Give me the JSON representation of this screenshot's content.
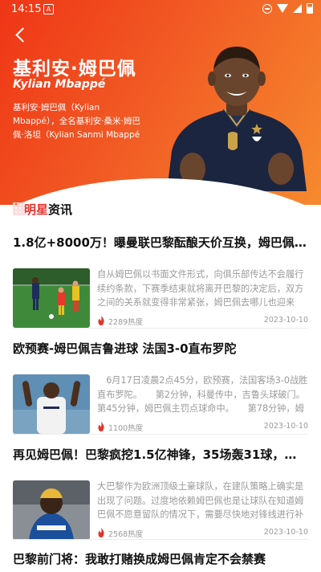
{
  "status": {
    "time": "14:15",
    "app_badge": "A"
  },
  "header": {
    "cn_name": "基利安·姆巴佩",
    "en_name": "Kylian Mbappé",
    "bio": "基利安·姆巴佩（Kylian Mbappé），全名基利安·桑米·姆巴佩·洛坦（Kylian Sanmi Mbappé"
  },
  "section": {
    "title_red": "明星",
    "title_black": "资讯"
  },
  "news": [
    {
      "title": "1.8亿+8000万！曝曼联巴黎酝酿天价互换，姆巴佩去英超...",
      "summary": "自从姆巴佩以书面文件形式，向俱乐部传达不会履行续约条款，下赛季结束就将离开巴黎的决定后，双方之间的关系就变得非常紧张，姆巴佩去哪儿也迎来了“第二季”。...",
      "heat": "2289热度",
      "date": "2023-10-10",
      "thumb": "match-photo"
    },
    {
      "title": "欧预赛-姆巴佩吉鲁进球 法国3-0直布罗陀",
      "summary": "　6月17日凌晨2点45分，欧预赛，法国客场3-0战胜直布罗陀。　　第2分钟，科曼传中，吉鲁头球破门。第45分钟，姆巴佩主罚点球命中。　　第78分钟，姆巴佩...",
      "heat": "1100热度",
      "date": "2023-10-10",
      "thumb": "player-photo"
    },
    {
      "title": "再见姆巴佩！巴黎疯挖1.5亿神锋，35场轰31球，内马尔...",
      "summary": "大巴黎作为欧洲顶级土豪球队，在建队策略上确实是出现了问题。过度地依赖姆巴佩也是让球队在知道姆巴佩不愿意留队的情况下，需要尽快地对锋线进行补强和升级。...",
      "heat": "2568热度",
      "date": "2023-10-10",
      "thumb": "striker-photo"
    },
    {
      "title": "巴黎前门将：我敢打赌换成姆巴佩肯定不会禁赛"
    }
  ]
}
